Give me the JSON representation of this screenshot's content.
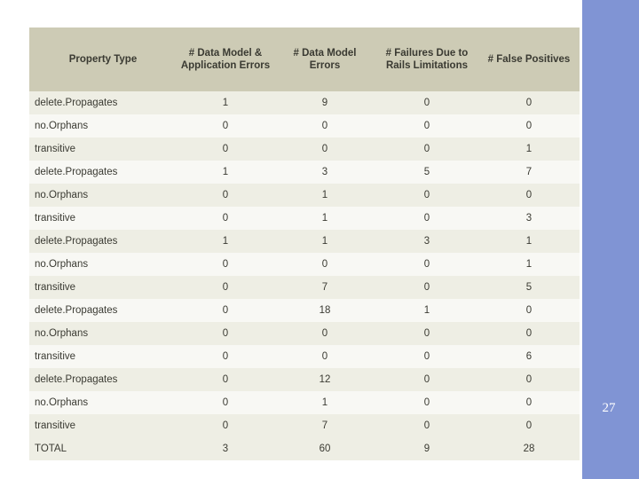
{
  "slide": {
    "number": "27",
    "band_color": "#8094d4"
  },
  "table": {
    "headers": [
      "Property Type",
      "# Data Model & Application Errors",
      "# Data Model Errors",
      "# Failures Due to Rails Limitations",
      "# False Positives"
    ],
    "rows": [
      {
        "label": "delete.Propagates",
        "values": [
          "1",
          "9",
          "0",
          "0"
        ]
      },
      {
        "label": "no.Orphans",
        "values": [
          "0",
          "0",
          "0",
          "0"
        ]
      },
      {
        "label": "transitive",
        "values": [
          "0",
          "0",
          "0",
          "1"
        ]
      },
      {
        "label": "delete.Propagates",
        "values": [
          "1",
          "3",
          "5",
          "7"
        ]
      },
      {
        "label": "no.Orphans",
        "values": [
          "0",
          "1",
          "0",
          "0"
        ]
      },
      {
        "label": "transitive",
        "values": [
          "0",
          "1",
          "0",
          "3"
        ]
      },
      {
        "label": "delete.Propagates",
        "values": [
          "1",
          "1",
          "3",
          "1"
        ]
      },
      {
        "label": "no.Orphans",
        "values": [
          "0",
          "0",
          "0",
          "1"
        ]
      },
      {
        "label": "transitive",
        "values": [
          "0",
          "7",
          "0",
          "5"
        ]
      },
      {
        "label": "delete.Propagates",
        "values": [
          "0",
          "18",
          "1",
          "0"
        ]
      },
      {
        "label": "no.Orphans",
        "values": [
          "0",
          "0",
          "0",
          "0"
        ]
      },
      {
        "label": "transitive",
        "values": [
          "0",
          "0",
          "0",
          "6"
        ]
      },
      {
        "label": "delete.Propagates",
        "values": [
          "0",
          "12",
          "0",
          "0"
        ]
      },
      {
        "label": "no.Orphans",
        "values": [
          "0",
          "1",
          "0",
          "0"
        ]
      },
      {
        "label": "transitive",
        "values": [
          "0",
          "7",
          "0",
          "0"
        ]
      },
      {
        "label": "TOTAL",
        "values": [
          "3",
          "60",
          "9",
          "28"
        ]
      }
    ]
  }
}
